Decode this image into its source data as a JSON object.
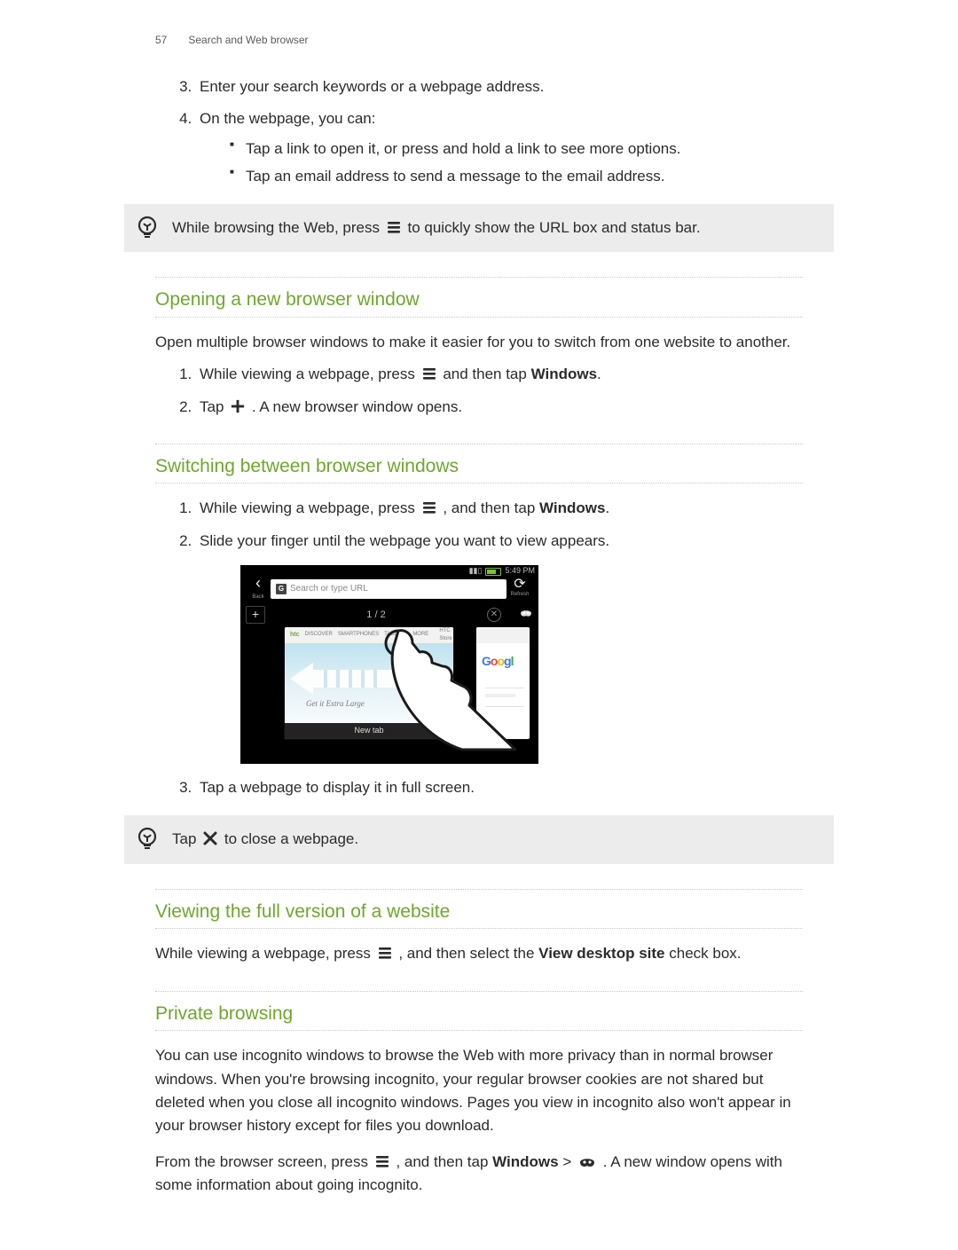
{
  "header": {
    "page_number": "57",
    "section_title": "Search and Web browser"
  },
  "intro_steps": {
    "s3": "Enter your search keywords or a webpage address.",
    "s4": "On the webpage, you can:",
    "bullets": [
      "Tap a link to open it, or press and hold a link to see more options.",
      "Tap an email address to send a message to the email address."
    ]
  },
  "tip1": {
    "before": "While browsing the Web, press ",
    "after": " to quickly show the URL box and status bar."
  },
  "sec_open": {
    "title": "Opening a new browser window",
    "intro": "Open multiple browser windows to make it easier for you to switch from one website to another.",
    "s1_before": "While viewing a webpage, press ",
    "s1_mid": " and then tap ",
    "s1_bold": "Windows",
    "s1_after": ".",
    "s2_before": "Tap ",
    "s2_after": ". A new browser window opens."
  },
  "sec_switch": {
    "title": "Switching between browser windows",
    "s1_before": "While viewing a webpage, press ",
    "s1_mid": ", and then tap ",
    "s1_bold": "Windows",
    "s1_after": ".",
    "s2": "Slide your finger until the webpage you want to view appears.",
    "s3": "Tap a webpage to display it in full screen."
  },
  "screenshot": {
    "status_time": "5:49 PM",
    "back_label": "Back",
    "url_placeholder": "Search or type URL",
    "refresh_label": "Refresh",
    "tab_counter": "1 / 2",
    "menu_items": [
      "htc",
      "DISCOVER",
      "SMARTPHONES",
      "TABLETS",
      "MORE"
    ],
    "menu_right": "HTC Store",
    "hero_tagline": "Get it Extra Large",
    "footer_label": "New tab",
    "google_logo_text": "Googl"
  },
  "tip2": {
    "before": "Tap ",
    "after": " to close a webpage."
  },
  "sec_full": {
    "title": "Viewing the full version of a website",
    "before": "While viewing a webpage, press ",
    "mid": ", and then select the ",
    "bold": "View desktop site",
    "after": " check box."
  },
  "sec_private": {
    "title": "Private browsing",
    "p1": "You can use incognito windows to browse the Web with more privacy than in normal browser windows. When you're browsing incognito, your regular browser cookies are not shared but deleted when you close all incognito windows. Pages you view in incognito also won't appear in your browser history except for files you download.",
    "p2_before": "From the browser screen, press ",
    "p2_mid": ", and then tap ",
    "p2_bold": "Windows",
    "p2_gt": " > ",
    "p2_after": ". A new window opens with some information about going incognito."
  }
}
